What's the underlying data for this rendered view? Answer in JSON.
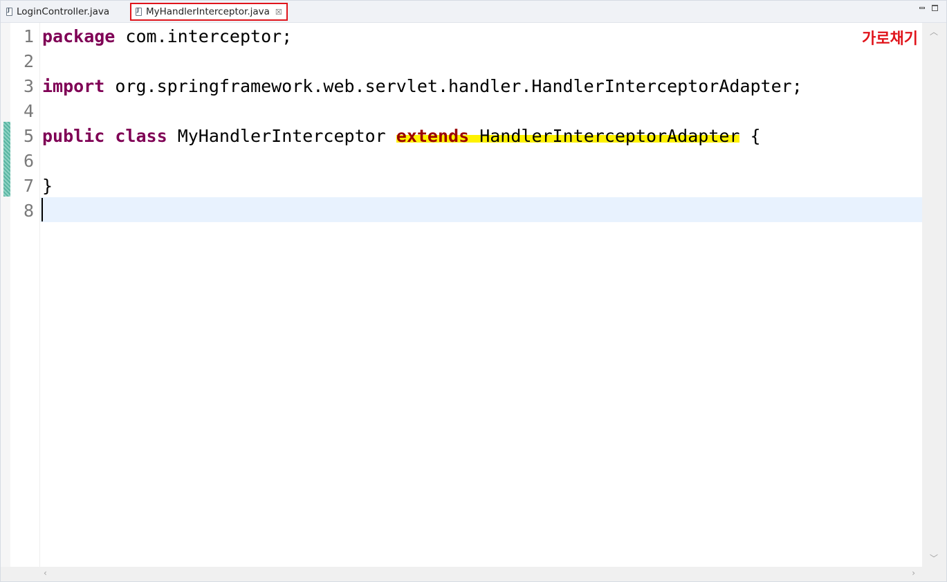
{
  "tabs": [
    {
      "label": "LoginController.java",
      "active": false
    },
    {
      "label": "MyHandlerInterceptor.java",
      "active": true,
      "close_glyph": "☒"
    }
  ],
  "annotation": {
    "text": "가로채기",
    "color": "#e0141b"
  },
  "editor": {
    "line_numbers": [
      "1",
      "2",
      "3",
      "4",
      "5",
      "6",
      "7",
      "8"
    ],
    "current_line": "8",
    "lines": {
      "l1": {
        "kw": "package",
        "rest": " com.interceptor;"
      },
      "l3": {
        "kw": "import",
        "rest": " org.springframework.web.servlet.handler.HandlerInterceptorAdapter;"
      },
      "l5": {
        "kw1": "public",
        "kw2": "class",
        "name": " MyHandlerInterceptor ",
        "hl_kw": "extends",
        "hl_type": " HandlerInterceptorAdapter",
        "rest": " {"
      },
      "l7": {
        "rest": "}"
      }
    }
  },
  "colors": {
    "keyword": "#7f0055",
    "highlight": "#fff200",
    "current_line_bg": "#e8f2fe",
    "active_tab_border": "#e0141b",
    "change_marker": "#5ab5a2"
  },
  "icons": {
    "tab_file": "java-file-icon",
    "minimize": "minimize-icon",
    "maximize": "maximize-icon"
  }
}
